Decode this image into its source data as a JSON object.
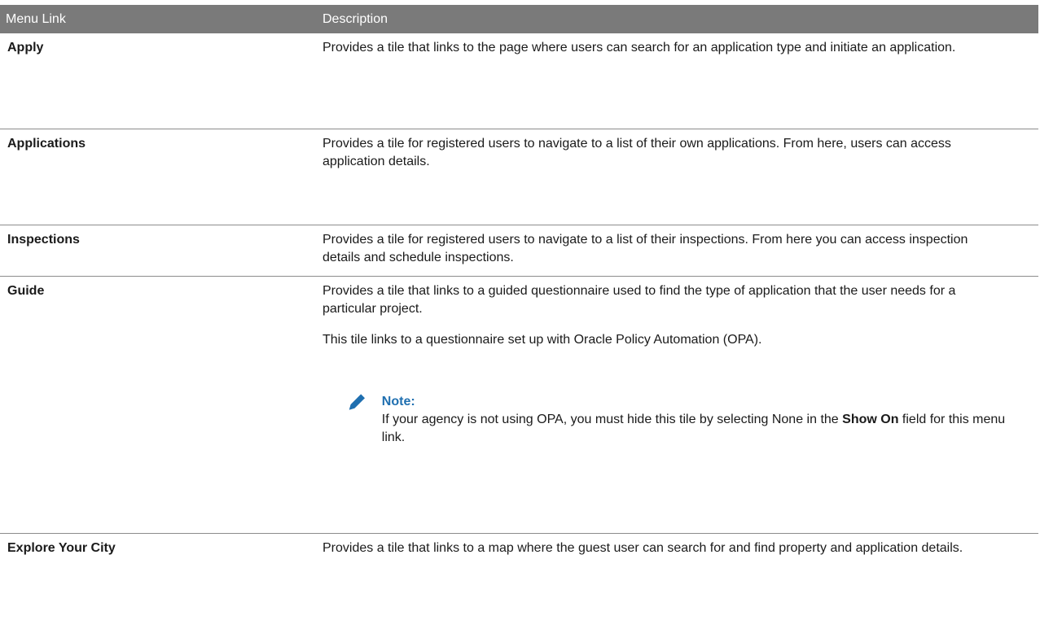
{
  "table": {
    "headers": {
      "menu_link": "Menu Link",
      "description": "Description"
    },
    "rows": [
      {
        "menu_link": "Apply",
        "description": "Provides a tile that links to the page where users can search for an application type and initiate an application."
      },
      {
        "menu_link": "Applications",
        "description": "Provides a tile for registered users to navigate to a list of their own applications. From here, users can access application details."
      },
      {
        "menu_link": "Inspections",
        "description": "Provides a tile for registered users to navigate to a list of their inspections. From here you can access inspection details and schedule inspections."
      },
      {
        "menu_link": "Guide",
        "description": "Provides a tile that links to a guided questionnaire used to find the type of application that the user needs for a particular project.",
        "description_2": "This tile links to a questionnaire set up with Oracle Policy Automation (OPA).",
        "note": {
          "icon": "pencil-icon",
          "title": "Note:",
          "text_before": "If your agency is not using OPA, you must hide this tile by selecting None in the ",
          "text_bold": "Show On",
          "text_after": " field for this menu link."
        }
      },
      {
        "menu_link": "Explore Your City",
        "description": "Provides a tile that links to a map where the guest user can search for and find property and application details."
      }
    ]
  },
  "colors": {
    "header_bg": "#7a7a7a",
    "note_title": "#1f6fb0",
    "note_icon": "#1f6fb0"
  }
}
